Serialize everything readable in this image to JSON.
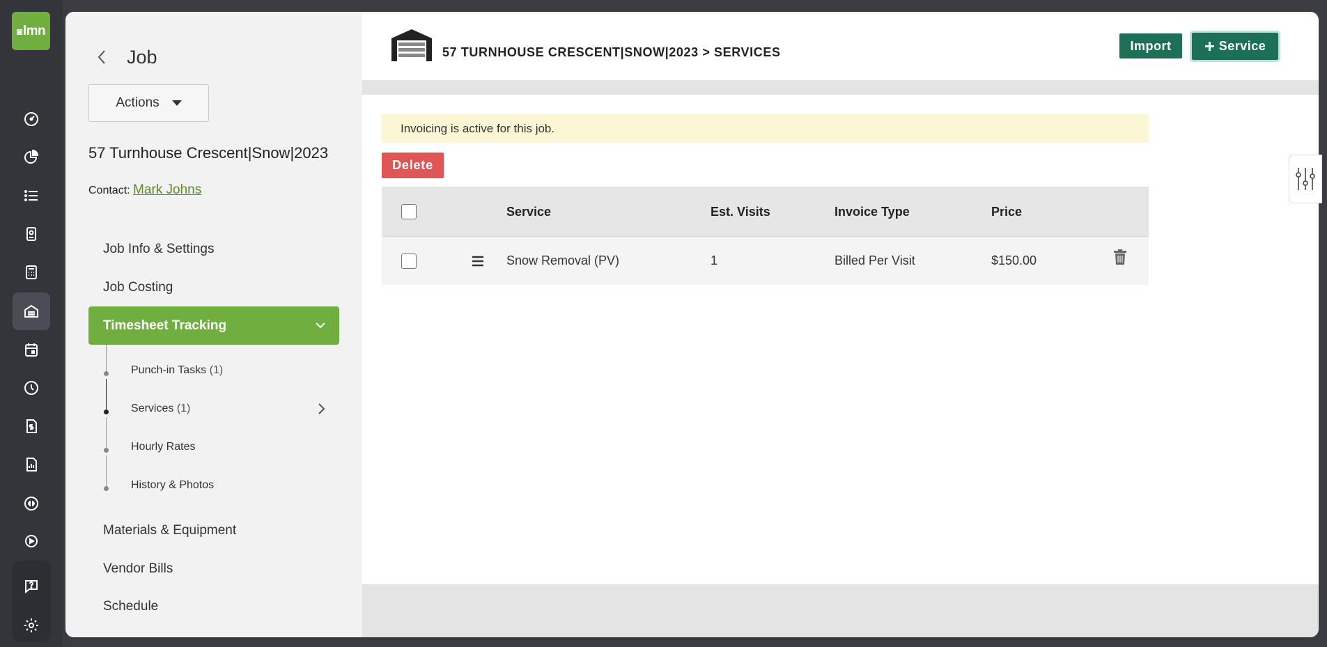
{
  "app": {
    "logo_text": "lmn",
    "brand_color": "#6fae3f",
    "accent_color": "#1d6f56",
    "danger_color": "#e05656"
  },
  "rail": {
    "icons": [
      "dashboard-icon",
      "pie-chart-icon",
      "list-icon",
      "contact-card-icon",
      "calculator-icon",
      "garage-icon",
      "calendar-icon",
      "clock-icon",
      "invoice-icon",
      "report-icon",
      "quickbooks-icon",
      "play-icon",
      "help-icon",
      "gear-icon"
    ],
    "active": "garage-icon"
  },
  "job_panel": {
    "title": "Job",
    "actions_label": "Actions",
    "job_name": "57 Turnhouse Crescent|Snow|2023",
    "contact_label": "Contact:",
    "contact_name": "Mark Johns",
    "nav": {
      "job_info": "Job Info & Settings",
      "job_costing": "Job Costing",
      "timesheet_tracking": "Timesheet Tracking",
      "materials": "Materials & Equipment",
      "vendor_bills": "Vendor Bills",
      "schedule": "Schedule"
    },
    "sub": {
      "punch_in": "Punch-in Tasks",
      "punch_in_count": "(1)",
      "services": "Services",
      "services_count": "(1)",
      "hourly_rates": "Hourly Rates",
      "history": "History & Photos"
    }
  },
  "header": {
    "breadcrumb": "57 TURNHOUSE CRESCENT|SNOW|2023 > SERVICES",
    "import_label": "Import",
    "service_label": "Service"
  },
  "notice": "Invoicing is active for this job.",
  "delete_label": "Delete",
  "table": {
    "columns": [
      "Service",
      "Est. Visits",
      "Invoice Type",
      "Price"
    ],
    "rows": [
      {
        "service": "Snow Removal (PV)",
        "visits": "1",
        "invoice_type": "Billed Per Visit",
        "price": "$150.00"
      }
    ]
  }
}
